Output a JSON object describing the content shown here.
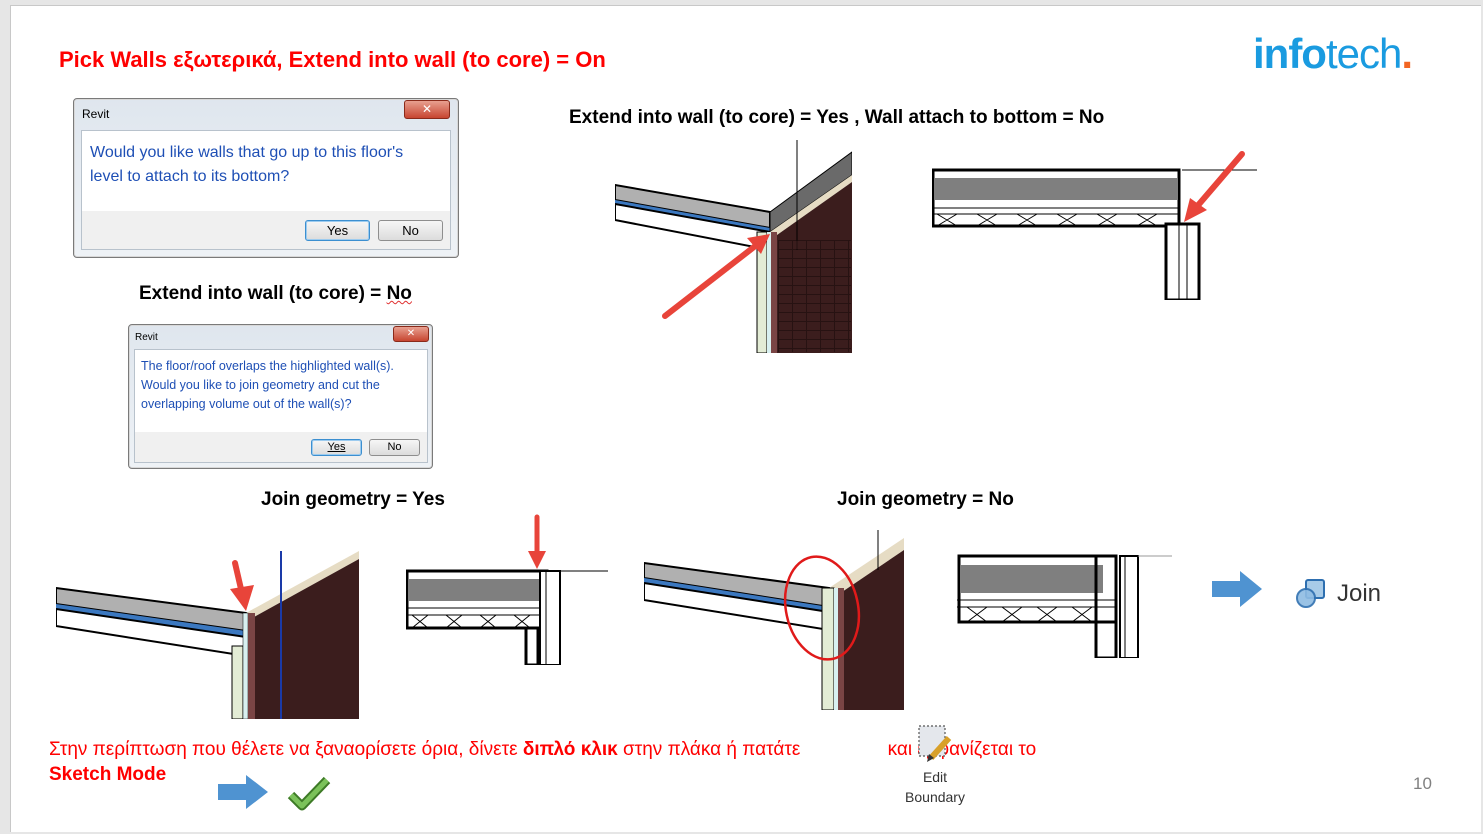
{
  "slide": {
    "title": "Pick Walls εξωτερικά, Extend into wall (to core) = On",
    "logo": {
      "part_bold": "info",
      "part_regular": "tech",
      "dot": ".",
      "brand_color": "#1a9be0",
      "dot_color": "#f26522"
    },
    "page_number": "10"
  },
  "dialog_attach": {
    "title": "Revit",
    "close_icon": "close-icon",
    "message_line1": "Would you like walls that go up to this floor's",
    "message_line2": "level to attach to its bottom?",
    "yes_label": "Yes",
    "no_label": "No"
  },
  "header_no_extend": {
    "prefix": "Extend into wall (to core) = ",
    "value": "No"
  },
  "dialog_join": {
    "title": "Revit",
    "close_icon": "close-icon",
    "message_line1": "The floor/roof overlaps the highlighted wall(s).",
    "message_line2": "Would you like to join geometry and cut the",
    "message_line3": "overlapping volume out of the wall(s)?",
    "yes_label": "Yes",
    "no_label": "No"
  },
  "header_extend_yes": "Extend into wall (to core) = Yes ,  Wall attach to bottom = No",
  "header_join_yes": "Join geometry = Yes",
  "header_join_no": "Join geometry = No",
  "join_tool": {
    "icon": "join-geometry-icon",
    "label": "Join"
  },
  "edit_boundary": {
    "icon": "edit-boundary-icon",
    "label_line1": "Edit",
    "label_line2": "Boundary"
  },
  "bottom_note": {
    "part1": "Στην περίπτωση που θέλετε να ξαναορίσετε όρια, δίνετε ",
    "bold1": "διπλό κλικ",
    "part2": " στην πλάκα ή πατάτε ",
    "part3": "και εμφανίζεται το",
    "bold2": "Sketch Mode"
  },
  "colors": {
    "title_red": "#ff0000",
    "arrow_red": "#e8443a",
    "arrow_blue": "#4f93d1",
    "check_green": "#5aa33c",
    "dialog_text": "#1e4fb5"
  }
}
